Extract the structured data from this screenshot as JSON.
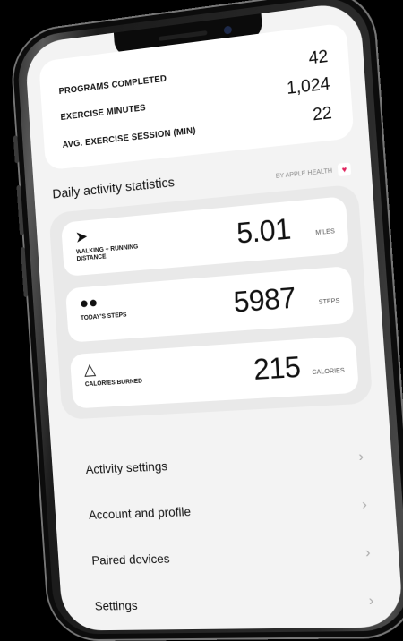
{
  "stats": [
    {
      "label": "PROGRAMS COMPLETED",
      "value": "42"
    },
    {
      "label": "EXERCISE MINUTES",
      "value": "1,024"
    },
    {
      "label": "AVG. EXERCISE SESSION (MIN)",
      "value": "22"
    }
  ],
  "daily": {
    "title": "Daily activity statistics",
    "source": "BY APPLE HEALTH",
    "heart_icon": "heart-icon"
  },
  "metrics": [
    {
      "icon": "running-icon",
      "label": "WALKING + RUNNING DISTANCE",
      "value": "5.01",
      "unit": "MILES"
    },
    {
      "icon": "footsteps-icon",
      "label": "TODAY'S STEPS",
      "value": "5987",
      "unit": "STEPS"
    },
    {
      "icon": "flame-icon",
      "label": "CALORIES BURNED",
      "value": "215",
      "unit": "CALORIES"
    }
  ],
  "menu": [
    {
      "label": "Activity settings"
    },
    {
      "label": "Account and profile"
    },
    {
      "label": "Paired devices"
    },
    {
      "label": "Settings"
    }
  ],
  "colors": {
    "background": "#000000",
    "screen": "#f3f3f3",
    "card": "#ffffff",
    "panel": "#e9e9e9",
    "heart": "#e0245e"
  }
}
